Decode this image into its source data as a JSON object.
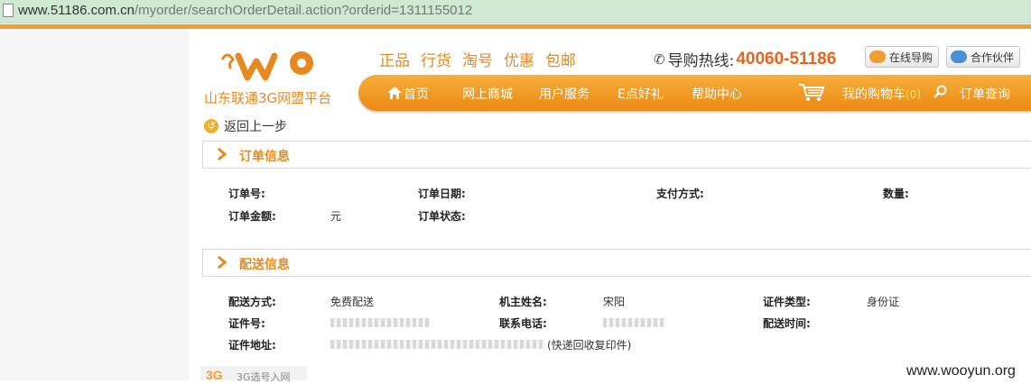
{
  "browser": {
    "url_host": "www.51186.com.cn",
    "url_path": "/myorder/searchOrderDetail.action?orderid=1311155012"
  },
  "header": {
    "logo_text": "山东联通3G网盟平台",
    "promo": [
      "正品",
      "行货",
      "淘号",
      "优惠",
      "包邮"
    ],
    "hotline_label": "导购热线:",
    "hotline_number": "40060-51186",
    "online_guide_label": "在线导购",
    "partner_label": "合作伙伴"
  },
  "nav": {
    "home": "首页",
    "mall": "网上商城",
    "service": "用户服务",
    "gift": "E点好礼",
    "help": "帮助中心",
    "cart": "我的购物车",
    "cart_count": "(0)",
    "order_query": "订单查询"
  },
  "back_label": "返回上一步",
  "order_info": {
    "title": "订单信息",
    "order_no_label": "订单号:",
    "order_date_label": "订单日期:",
    "payment_label": "支付方式:",
    "quantity_label": "数量:",
    "amount_label": "订单金额:",
    "amount_unit": "元",
    "status_label": "订单状态:"
  },
  "delivery_info": {
    "title": "配送信息",
    "method_label": "配送方式:",
    "method_value": "免费配送",
    "owner_label": "机主姓名:",
    "owner_value": "宋阳",
    "id_type_label": "证件类型:",
    "id_type_value": "身份证",
    "id_no_label": "证件号:",
    "phone_label": "联系电话:",
    "delivery_time_label": "配送时间:",
    "address_label": "证件地址:",
    "address_suffix": "(快递回收复印件)"
  },
  "footer": {
    "logo_3g": "3G",
    "logo_text": "3G选号入网"
  },
  "watermark": "www.wooyun.org",
  "colors": {
    "brand_orange": "#e8891f",
    "nav_orange": "#ec8a13",
    "hotline_red": "#e8641f",
    "url_bar_green": "#cfe9d3"
  }
}
